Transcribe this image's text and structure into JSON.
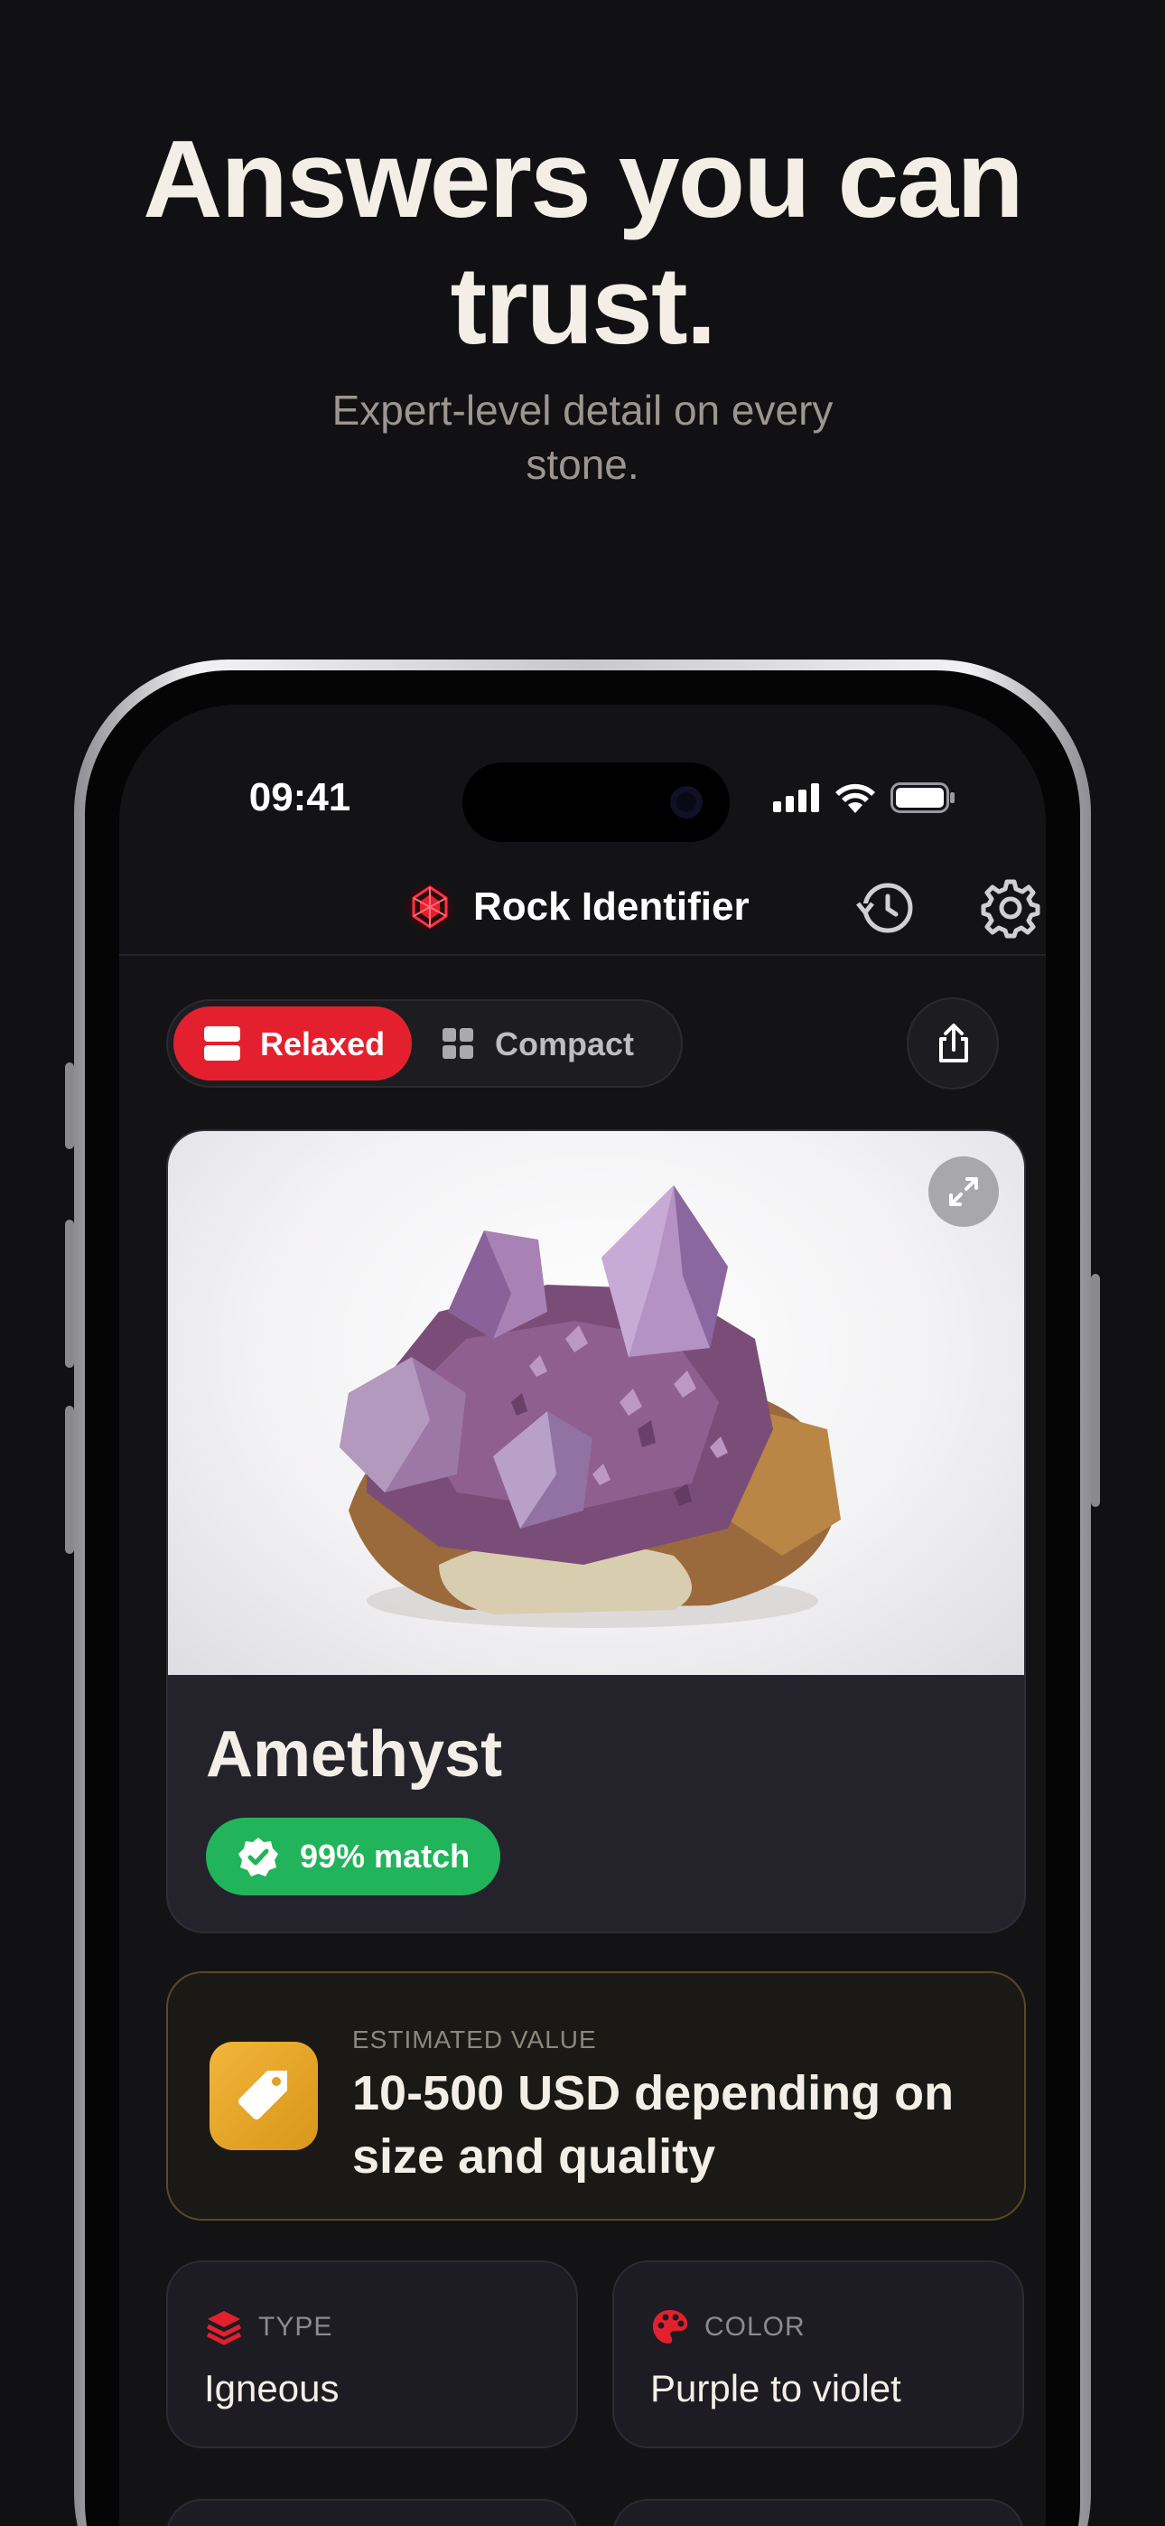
{
  "hero": {
    "title_line1": "Answers you can",
    "title_line2": "trust.",
    "subtitle": "Expert-level detail on every stone."
  },
  "status_bar": {
    "time": "09:41"
  },
  "header": {
    "app_title": "Rock Identifier",
    "icons": [
      "rock-logo-icon",
      "history-icon",
      "gear-icon"
    ]
  },
  "view_toggle": {
    "relaxed_label": "Relaxed",
    "compact_label": "Compact",
    "selected": "Relaxed"
  },
  "result": {
    "name": "Amethyst",
    "match_label": "99% match"
  },
  "estimated_value": {
    "label": "ESTIMATED VALUE",
    "text": "10-500 USD depending on size and quality"
  },
  "properties": [
    {
      "label": "TYPE",
      "value": "Igneous",
      "icon": "layers-icon"
    },
    {
      "label": "COLOR",
      "value": "Purple to violet",
      "icon": "palette-icon"
    }
  ],
  "colors": {
    "background": "#111113",
    "accent_red": "#e4202f",
    "match_green": "#21b45a",
    "value_gold": "#e9a82c"
  }
}
